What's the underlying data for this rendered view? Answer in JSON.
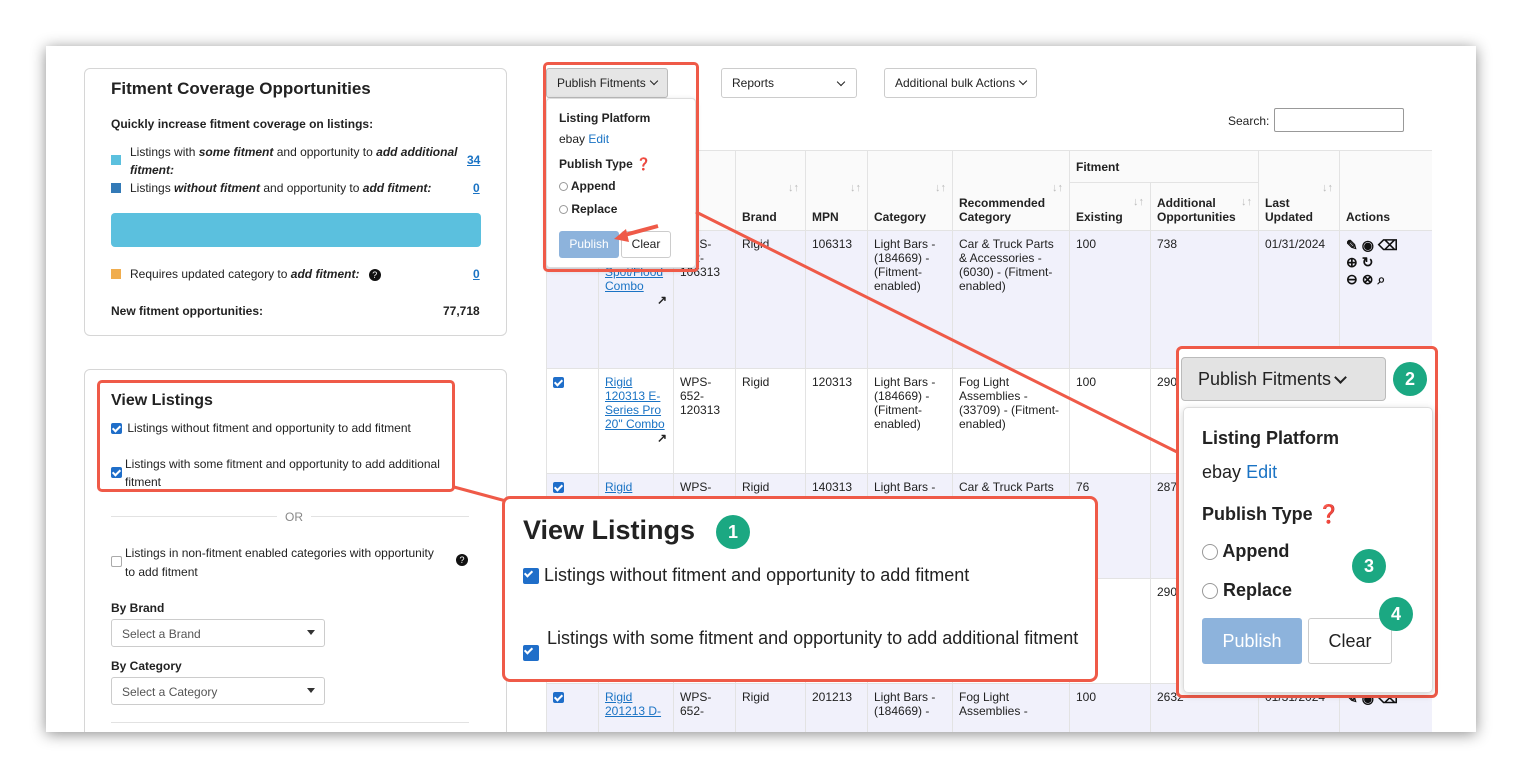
{
  "coverage": {
    "title": "Fitment Coverage Opportunities",
    "subtitle": "Quickly increase fitment coverage on listings:",
    "row1_a": "Listings with ",
    "row1_b": "some fitment",
    "row1_c": " and opportunity to ",
    "row1_d": "add additional fitment:",
    "row1_count": "34",
    "row2_a": "Listings ",
    "row2_b": "without fitment",
    "row2_c": " and opportunity to ",
    "row2_d": "add fitment:",
    "row2_count": "0",
    "row3_a": "Requires updated category to ",
    "row3_b": "add fitment:",
    "row3_count": "0",
    "new_label": "New fitment opportunities:",
    "new_value": "77,718",
    "colors": {
      "some": "#5bc0de",
      "without": "#337ab7",
      "category": "#f0ad4e"
    }
  },
  "view_listings": {
    "title": "View Listings",
    "opt1": "Listings without fitment and opportunity to add fitment",
    "opt2": "Listings with some fitment and opportunity to add additional fitment",
    "or": "OR",
    "opt3": "Listings in non-fitment enabled categories with opportunity to add fitment",
    "by_brand": "By Brand",
    "brand_placeholder": "Select a Brand",
    "by_category": "By Category",
    "category_placeholder": "Select a Category"
  },
  "toolbar": {
    "publish": "Publish Fitments",
    "reports": "Reports",
    "bulk": "Additional bulk Actions",
    "search": "Search:"
  },
  "publish_menu": {
    "platform_label": "Listing Platform",
    "platform": "ebay",
    "edit": "Edit",
    "type_label": "Publish Type",
    "append": "Append",
    "replace": "Replace",
    "publish": "Publish",
    "clear": "Clear"
  },
  "table": {
    "headers": {
      "brand": "Brand",
      "mpn": "MPN",
      "category": "Category",
      "recommended": "Recommended Category",
      "fitment_group": "Fitment",
      "existing": "Existing",
      "additional": "Additional Opportunities",
      "last_updated": "Last Updated",
      "actions": "Actions"
    },
    "rows": [
      {
        "title": "Series Pro 6\" Spot/Flood Combo",
        "sku": "WPS-652-106313",
        "brand": "Rigid",
        "mpn": "106313",
        "category": "Light Bars - (184669) - (Fitment-enabled)",
        "recommended": "Car & Truck Parts & Accessories - (6030) - (Fitment-enabled)",
        "existing": "100",
        "additional": "738",
        "updated": "01/31/2024"
      },
      {
        "title": "Rigid 120313 E-Series Pro 20\" Combo",
        "sku": "WPS-652-120313",
        "brand": "Rigid",
        "mpn": "120313",
        "category": "Light Bars - (184669) - (Fitment-enabled)",
        "recommended": "Fog Light Assemblies - (33709) - (Fitment-enabled)",
        "existing": "100",
        "additional": "290",
        "updated": ""
      },
      {
        "title": "Rigid",
        "sku": "WPS-",
        "brand": "Rigid",
        "mpn": "140313",
        "category": "Light Bars -",
        "recommended": "Car & Truck Parts &",
        "existing": "76",
        "additional": "287",
        "updated": ""
      },
      {
        "title": "",
        "sku": "",
        "brand": "",
        "mpn": "",
        "category": "",
        "recommended": "",
        "existing": "",
        "additional": "290",
        "updated": ""
      },
      {
        "title": "Rigid 201213 D-",
        "sku": "WPS-652-",
        "brand": "Rigid",
        "mpn": "201213",
        "category": "Light Bars - (184669) -",
        "recommended": "Fog Light Assemblies -",
        "existing": "100",
        "additional": "2632",
        "updated": "01/31/2024"
      }
    ]
  },
  "callouts": {
    "view_title": "View Listings",
    "view_opt1": "Listings without fitment and opportunity to add fitment",
    "view_opt2": "Listings with some fitment and opportunity to add additional fitment",
    "b1": "1",
    "b2": "2",
    "b3": "3",
    "b4": "4"
  }
}
